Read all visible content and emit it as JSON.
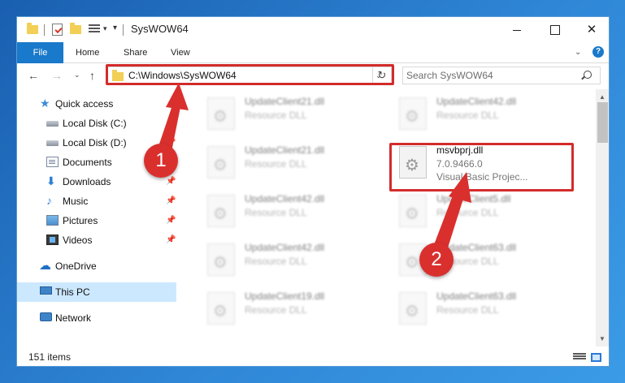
{
  "window": {
    "title": "SysWOW64",
    "controls": {
      "minimize": "",
      "maximize": "",
      "close": "✕"
    }
  },
  "ribbon": {
    "tabs": [
      "File",
      "Home",
      "Share",
      "View"
    ],
    "expand": "⌄",
    "help": "?"
  },
  "nav": {
    "back": "←",
    "forward": "→",
    "recent": "⌄",
    "up": "↑",
    "address": "C:\\Windows\\SysWOW64",
    "address_dropdown": "⌄",
    "refresh": "↻",
    "search_placeholder": "Search SysWOW64"
  },
  "sidebar": {
    "items": [
      {
        "label": "Quick access",
        "icon": "star-icon",
        "pinned": false
      },
      {
        "label": "Local Disk (C:)",
        "icon": "drive-icon",
        "pinned": false
      },
      {
        "label": "Local Disk (D:)",
        "icon": "drive-icon",
        "pinned": true
      },
      {
        "label": "Documents",
        "icon": "documents-icon",
        "pinned": true
      },
      {
        "label": "Downloads",
        "icon": "download-icon",
        "pinned": true
      },
      {
        "label": "Music",
        "icon": "music-icon",
        "pinned": true
      },
      {
        "label": "Pictures",
        "icon": "pictures-icon",
        "pinned": true
      },
      {
        "label": "Videos",
        "icon": "videos-icon",
        "pinned": true
      },
      {
        "label": "OneDrive",
        "icon": "onedrive-icon",
        "pinned": false
      },
      {
        "label": "This PC",
        "icon": "pc-icon",
        "pinned": false,
        "selected": true
      },
      {
        "label": "Network",
        "icon": "network-icon",
        "pinned": false
      }
    ],
    "pin_glyph": "📌"
  },
  "files": [
    {
      "name": "UpdateClient21.dll",
      "line1": "Resource DLL",
      "line2": "",
      "blurred": true
    },
    {
      "name": "UpdateClient42.dll",
      "line1": "Resource DLL",
      "line2": "",
      "blurred": true
    },
    {
      "name": "UpdateClient21.dll",
      "line1": "Resource DLL",
      "line2": "",
      "blurred": true
    },
    {
      "name": "msvbprj.dll",
      "line1": "7.0.9466.0",
      "line2": "Visual Basic Projec...",
      "blurred": false
    },
    {
      "name": "UpdateClient42.dll",
      "line1": "Resource DLL",
      "line2": "",
      "blurred": true
    },
    {
      "name": "UpdateClient5.dll",
      "line1": "Resource DLL",
      "line2": "",
      "blurred": true
    },
    {
      "name": "UpdateClient42.dll",
      "line1": "Resource DLL",
      "line2": "",
      "blurred": true
    },
    {
      "name": "UpdateClient63.dll",
      "line1": "Resource DLL",
      "line2": "",
      "blurred": true
    },
    {
      "name": "UpdateClient19.dll",
      "line1": "Resource DLL",
      "line2": "",
      "blurred": true
    },
    {
      "name": "UpdateClient63.dll",
      "line1": "Resource DLL",
      "line2": "",
      "blurred": true
    }
  ],
  "status": {
    "item_count": "151 items"
  },
  "callouts": {
    "step1": "1",
    "step2": "2",
    "color": "#d9302e"
  }
}
